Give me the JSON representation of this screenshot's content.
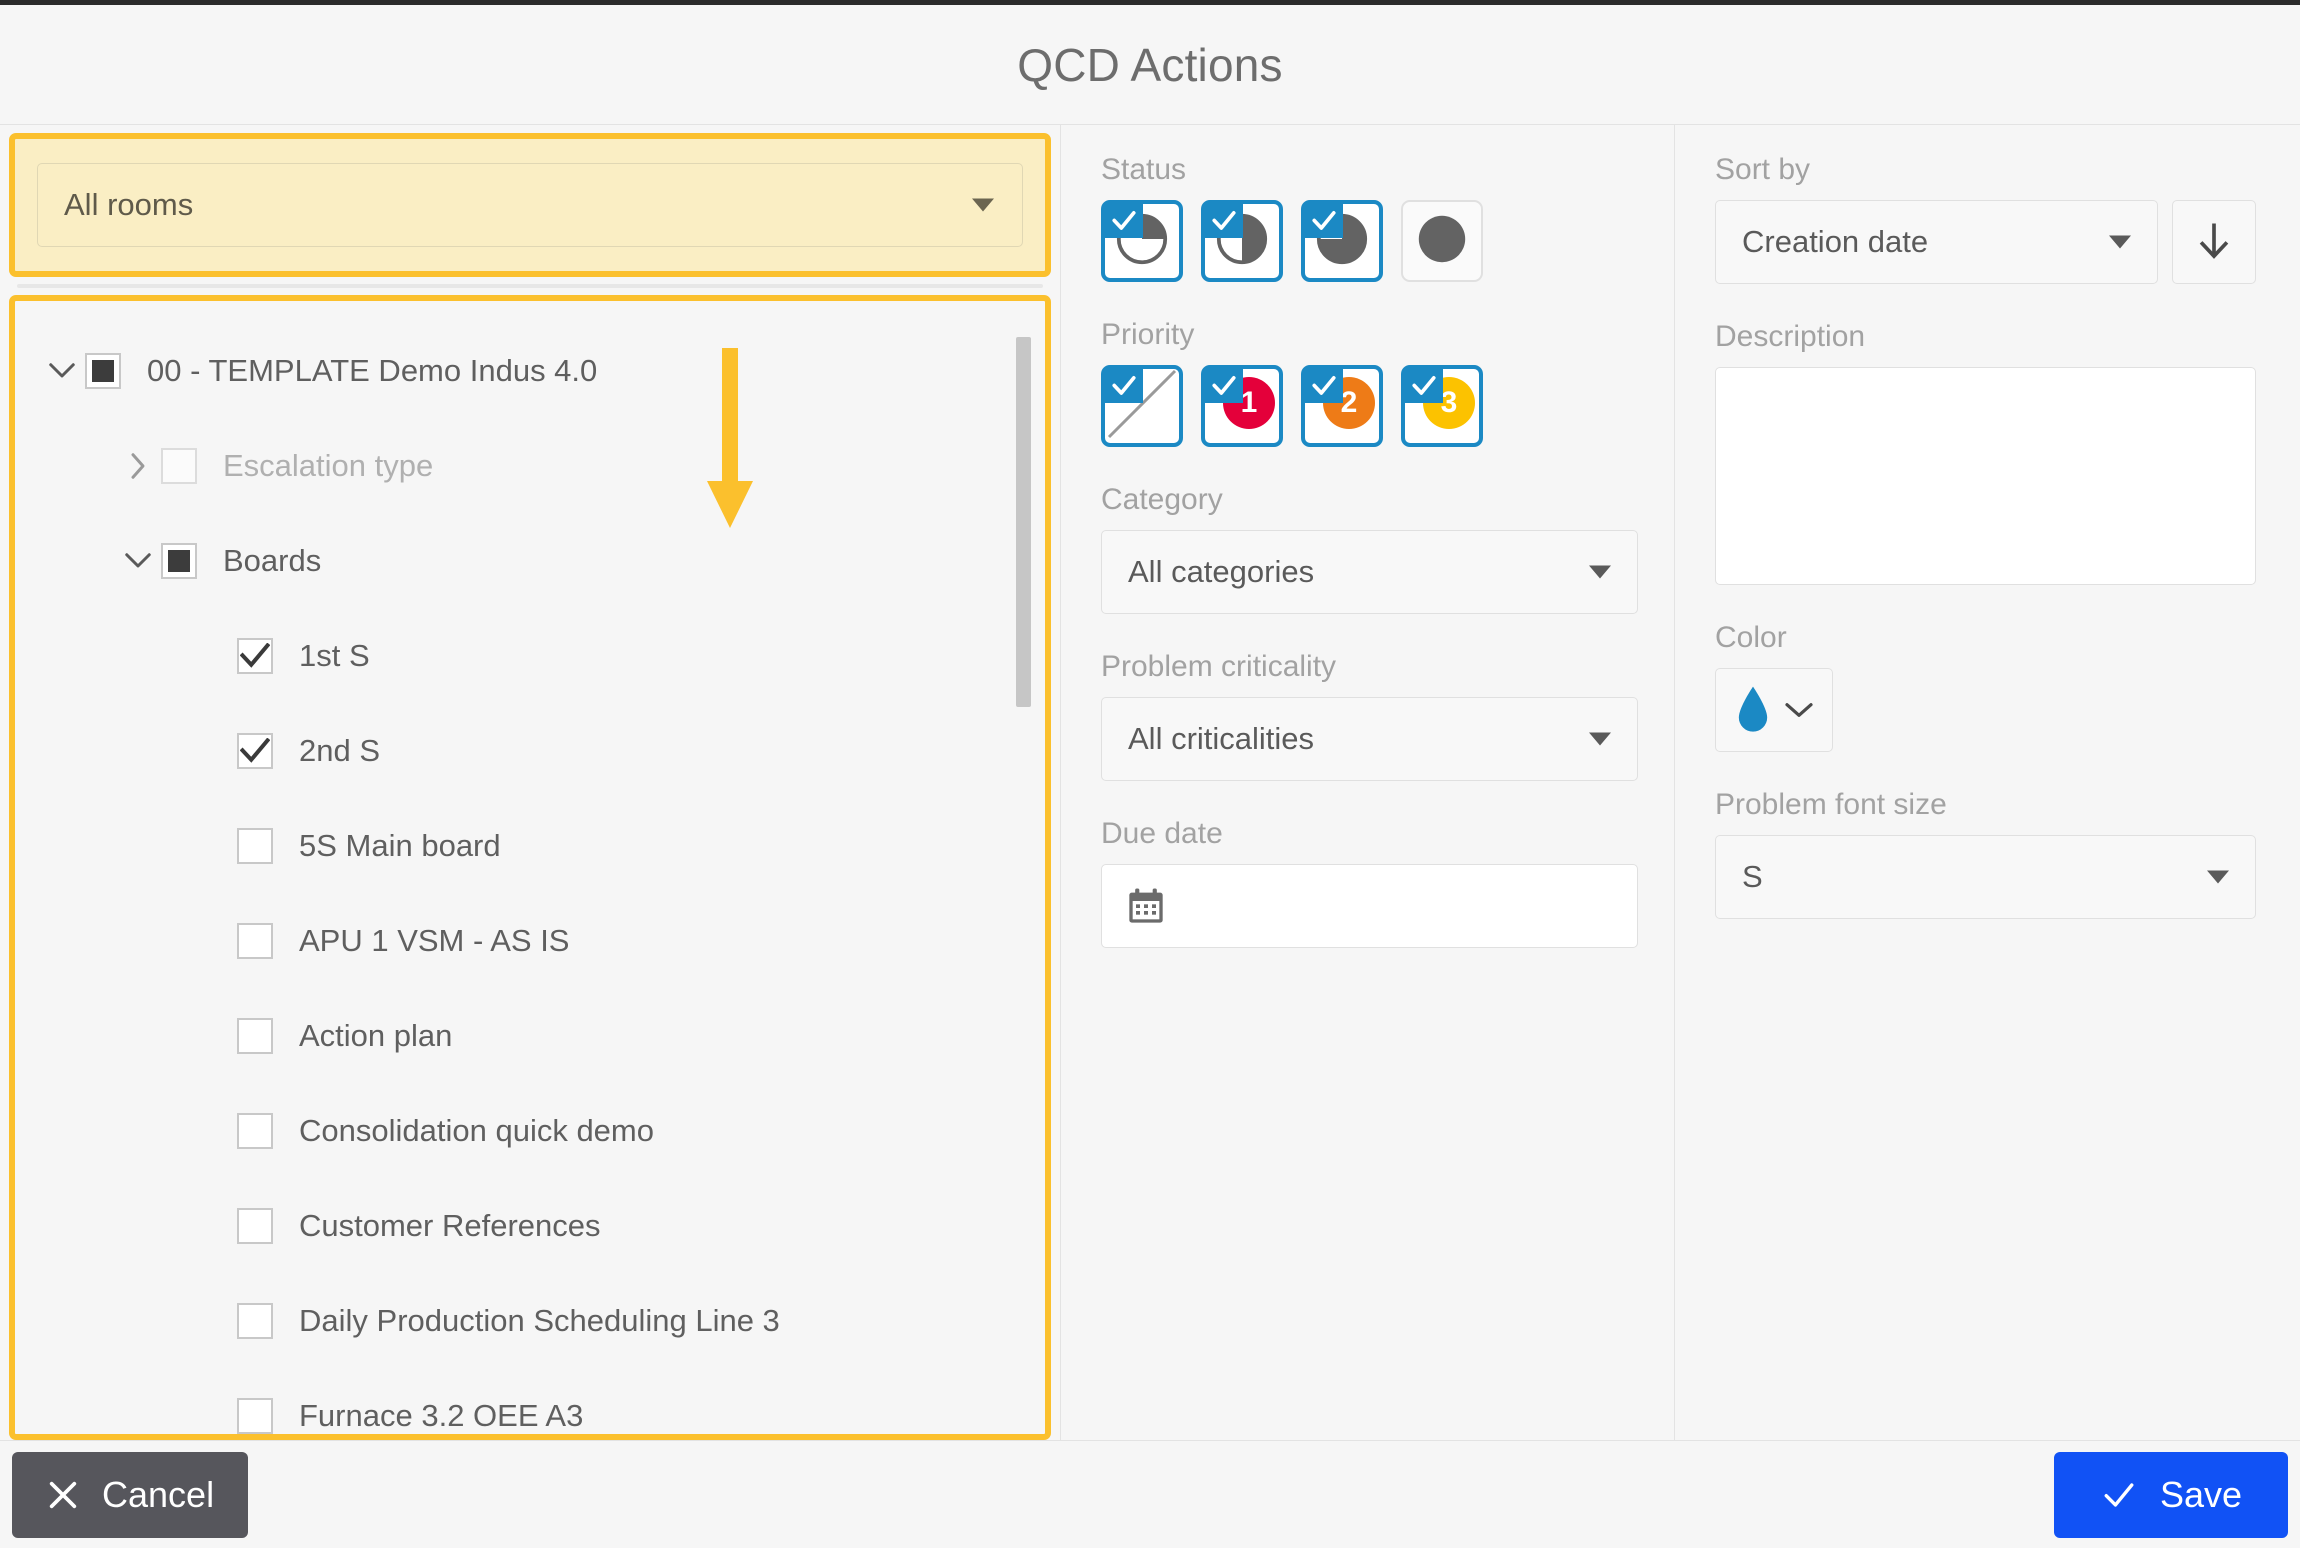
{
  "header": {
    "title": "QCD Actions"
  },
  "rooms": {
    "label": "rooms-filter",
    "selected": "All rooms",
    "caret_icon": "chevron-down-icon"
  },
  "tree": {
    "items": [
      {
        "label": "00 - TEMPLATE Demo Indus 4.0",
        "indent": 0,
        "state": "indeterminate",
        "twisty": "expanded",
        "disabled": false
      },
      {
        "label": "Escalation type",
        "indent": 1,
        "state": "unchecked",
        "twisty": "collapsed",
        "disabled": true
      },
      {
        "label": "Boards",
        "indent": 1,
        "state": "indeterminate",
        "twisty": "expanded",
        "disabled": false
      },
      {
        "label": "1st S",
        "indent": 2,
        "state": "checked",
        "twisty": "none",
        "disabled": false
      },
      {
        "label": "2nd S",
        "indent": 2,
        "state": "checked",
        "twisty": "none",
        "disabled": false
      },
      {
        "label": "5S Main board",
        "indent": 2,
        "state": "unchecked",
        "twisty": "none",
        "disabled": false
      },
      {
        "label": "APU 1 VSM - AS IS",
        "indent": 2,
        "state": "unchecked",
        "twisty": "none",
        "disabled": false
      },
      {
        "label": "Action plan",
        "indent": 2,
        "state": "unchecked",
        "twisty": "none",
        "disabled": false
      },
      {
        "label": "Consolidation quick demo",
        "indent": 2,
        "state": "unchecked",
        "twisty": "none",
        "disabled": false
      },
      {
        "label": "Customer References",
        "indent": 2,
        "state": "unchecked",
        "twisty": "none",
        "disabled": false
      },
      {
        "label": "Daily Production Scheduling Line 3",
        "indent": 2,
        "state": "unchecked",
        "twisty": "none",
        "disabled": false
      },
      {
        "label": "Furnace 3.2 OEE A3",
        "indent": 2,
        "state": "unchecked",
        "twisty": "none",
        "disabled": false
      }
    ]
  },
  "status": {
    "label": "Status",
    "options": [
      {
        "name": "status-not-started",
        "icon": "pie-0-icon",
        "selected": true
      },
      {
        "name": "status-half",
        "icon": "pie-50-icon",
        "selected": true
      },
      {
        "name": "status-three-quarter",
        "icon": "pie-75-icon",
        "selected": true
      },
      {
        "name": "status-done",
        "icon": "pie-100-icon",
        "selected": false
      }
    ]
  },
  "priority": {
    "label": "Priority",
    "options": [
      {
        "name": "priority-none",
        "icon": "slash-icon",
        "badge": "",
        "color": "",
        "selected": true
      },
      {
        "name": "priority-1",
        "icon": "badge-icon",
        "badge": "1",
        "color": "#e4003a",
        "selected": true
      },
      {
        "name": "priority-2",
        "icon": "badge-icon",
        "badge": "2",
        "color": "#ee7b17",
        "selected": true
      },
      {
        "name": "priority-3",
        "icon": "badge-icon",
        "badge": "3",
        "color": "#fcc200",
        "selected": true
      }
    ]
  },
  "category": {
    "label": "Category",
    "selected": "All categories"
  },
  "criticality": {
    "label": "Problem criticality",
    "selected": "All criticalities"
  },
  "due_date": {
    "label": "Due date",
    "value": "",
    "icon": "calendar-icon"
  },
  "sort_by": {
    "label": "Sort by",
    "selected": "Creation date",
    "direction_icon": "arrow-down-icon"
  },
  "description": {
    "label": "Description",
    "value": ""
  },
  "color": {
    "label": "Color",
    "value_icon": "droplet-icon",
    "value_hex": "#1b89c4",
    "caret_icon": "chevron-down-icon"
  },
  "font_size": {
    "label": "Problem font size",
    "selected": "S"
  },
  "footer": {
    "cancel_label": "Cancel",
    "cancel_icon": "close-icon",
    "save_label": "Save",
    "save_icon": "check-icon"
  },
  "annotation": {
    "arrow_icon": "down-arrow-annotation",
    "color": "#fbc02d"
  }
}
